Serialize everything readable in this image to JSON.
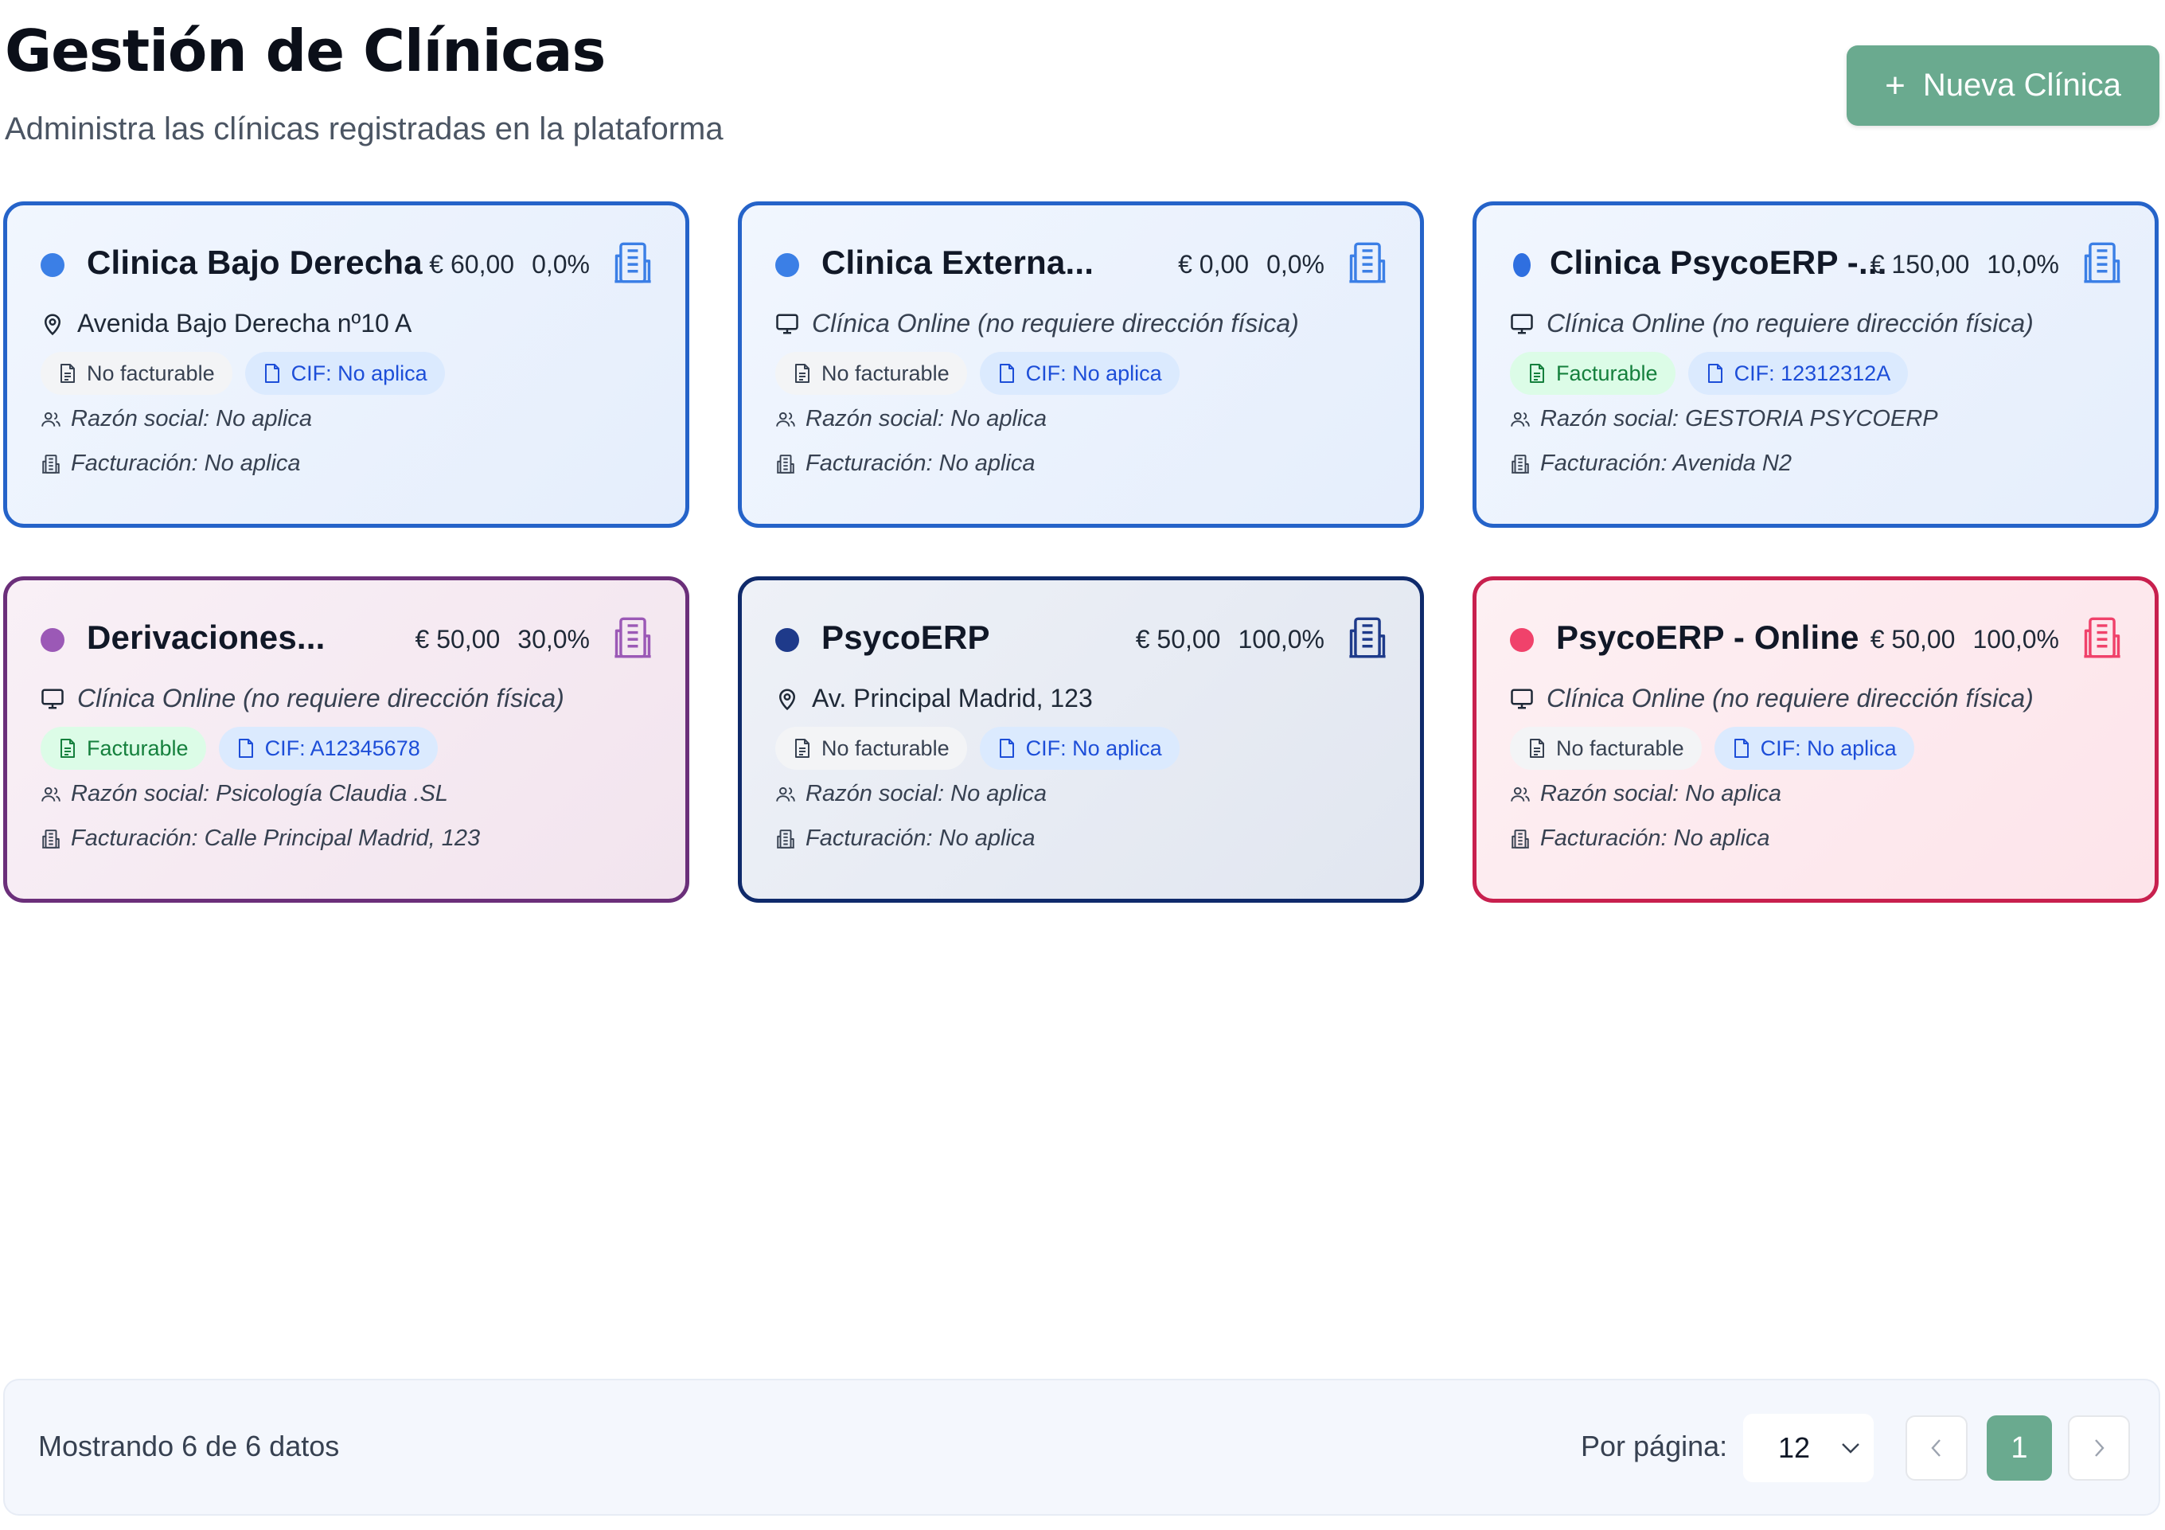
{
  "header": {
    "title": "Gestión de Clínicas",
    "subtitle": "Administra las clínicas registradas en la plataforma",
    "new_button": "Nueva Clínica"
  },
  "clinics": [
    {
      "name": "Clinica Bajo Derecha",
      "price": "€ 60,00",
      "percent": "0,0%",
      "color": "#3b7fe6",
      "address_type": "location",
      "address": "Avenida Bajo Derecha nº10 A",
      "billing_status": "No facturable",
      "cif": "CIF: No aplica",
      "razon_social": "Razón social: No aplica",
      "facturacion": "Facturación: No aplica"
    },
    {
      "name": "Clinica Externa...",
      "price": "€ 0,00",
      "percent": "0,0%",
      "color": "#3b7fe6",
      "address_type": "online",
      "address": "Clínica Online (no requiere dirección física)",
      "billing_status": "No facturable",
      "cif": "CIF: No aplica",
      "razon_social": "Razón social: No aplica",
      "facturacion": "Facturación: No aplica"
    },
    {
      "name": "Clinica PsycoERP -...",
      "price": "€ 150,00",
      "percent": "10,0%",
      "color": "#2f6fe0",
      "address_type": "online",
      "address": "Clínica Online (no requiere dirección física)",
      "billing_status": "Facturable",
      "cif": "CIF: 12312312A",
      "razon_social": "Razón social: GESTORIA PSYCOERP",
      "facturacion": "Facturación: Avenida N2"
    },
    {
      "name": "Derivaciones...",
      "price": "€ 50,00",
      "percent": "30,0%",
      "color": "#9b59b6",
      "address_type": "online",
      "address": "Clínica Online (no requiere dirección física)",
      "billing_status": "Facturable",
      "cif": "CIF: A12345678",
      "razon_social": "Razón social: Psicología Claudia .SL",
      "facturacion": "Facturación: Calle Principal Madrid, 123"
    },
    {
      "name": "PsycoERP",
      "price": "€ 50,00",
      "percent": "100,0%",
      "color": "#1e3a8a",
      "address_type": "location",
      "address": "Av. Principal Madrid, 123",
      "billing_status": "No facturable",
      "cif": "CIF: No aplica",
      "razon_social": "Razón social: No aplica",
      "facturacion": "Facturación: No aplica"
    },
    {
      "name": "PsycoERP - Online",
      "price": "€ 50,00",
      "percent": "100,0%",
      "color": "#f0426b",
      "address_type": "online",
      "address": "Clínica Online (no requiere dirección física)",
      "billing_status": "No facturable",
      "cif": "CIF: No aplica",
      "razon_social": "Razón social: No aplica",
      "facturacion": "Facturación: No aplica"
    }
  ],
  "footer": {
    "showing": "Mostrando 6 de 6 datos",
    "per_page_label": "Por página:",
    "per_page_value": "12",
    "current_page": "1"
  },
  "colors": {
    "accent": "#6aaa8f",
    "blue_border": "#2563c9",
    "purple_border": "#6b2f7a",
    "navy_border": "#0f2a6b",
    "pink_border": "#c8204e"
  }
}
